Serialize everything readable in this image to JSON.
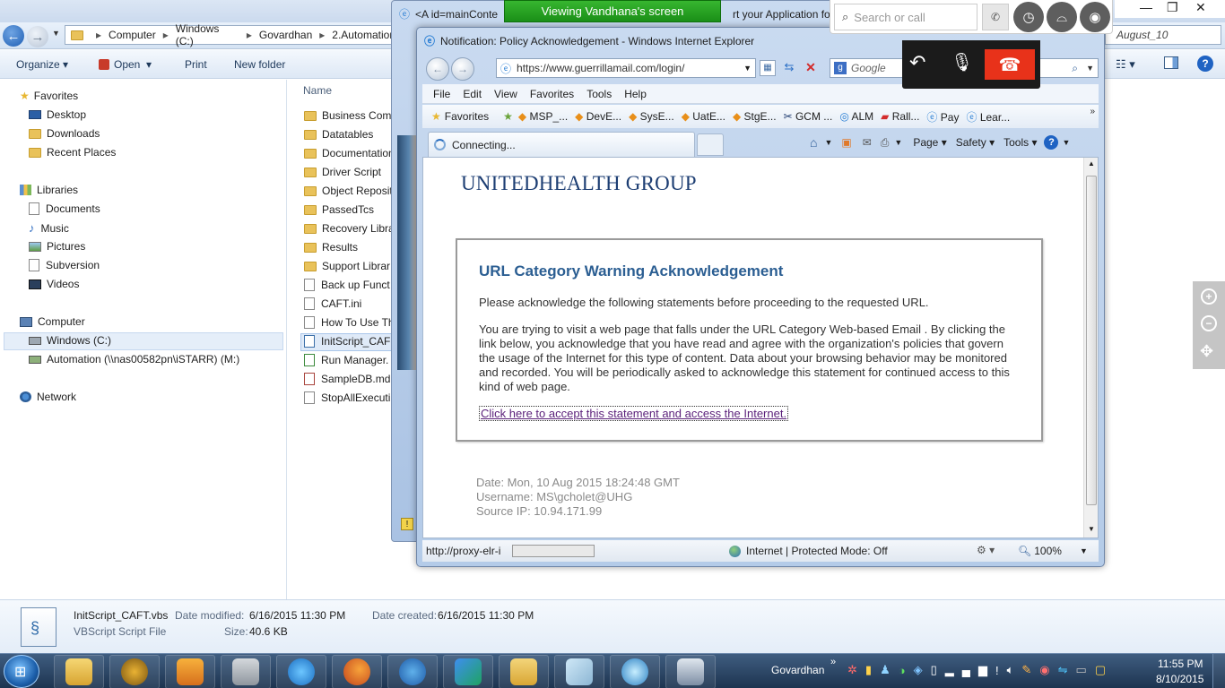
{
  "explorer": {
    "breadcrumb": [
      "Computer",
      "Windows (C:)",
      "Govardhan",
      "2.Automation"
    ],
    "toolbar": {
      "organize": "Organize",
      "open": "Open",
      "print": "Print",
      "new_folder": "New folder"
    },
    "column_header": "Name",
    "right_crumb": "August_10",
    "nav": {
      "favorites": "Favorites",
      "favorites_items": [
        "Desktop",
        "Downloads",
        "Recent Places"
      ],
      "libraries": "Libraries",
      "library_items": [
        "Documents",
        "Music",
        "Pictures",
        "Subversion",
        "Videos"
      ],
      "computer": "Computer",
      "computer_items": [
        "Windows (C:)",
        "Automation (\\\\nas00582pn\\iSTARR) (M:)"
      ],
      "network": "Network"
    },
    "files": [
      "Business Comp",
      "Datatables",
      "Documentation",
      "Driver Script",
      "Object Reposit",
      "PassedTcs",
      "Recovery Libra",
      "Results",
      "Support Librar",
      "Back up Funct",
      "CAFT.ini",
      "How To Use Th",
      "InitScript_CAF",
      "Run Manager.",
      "SampleDB.md",
      "StopAllExecuti"
    ],
    "details": {
      "filename": "InitScript_CAFT.vbs",
      "filetype": "VBScript Script File",
      "modified_label": "Date modified:",
      "modified": "6/16/2015 11:30 PM",
      "created_label": "Date created:",
      "created": "6/16/2015 11:30 PM",
      "size_label": "Size:",
      "size": "40.6 KB"
    }
  },
  "back_window": {
    "title": "<A id=mainConte",
    "title_right": "rt your Application for"
  },
  "screenshare": {
    "banner": "Viewing Vandhana's screen",
    "search_placeholder": "Search or call"
  },
  "ie": {
    "title": "Notification: Policy Acknowledgement - Windows Internet Explorer",
    "url": "https://www.guerrillamail.com/login/",
    "search_engine": "Google",
    "menu": [
      "File",
      "Edit",
      "View",
      "Favorites",
      "Tools",
      "Help"
    ],
    "favorites_label": "Favorites",
    "fav_links": [
      "MSP_...",
      "DevE...",
      "SysE...",
      "UatE...",
      "StgE...",
      "GCM ...",
      "ALM",
      "Rall...",
      "Pay",
      "Lear..."
    ],
    "tab_label": "Connecting...",
    "cmd": {
      "page": "Page",
      "safety": "Safety",
      "tools": "Tools"
    },
    "status_url": "http://proxy-elr-i",
    "zone": "Internet | Protected Mode: Off",
    "zoom": "100%"
  },
  "page": {
    "logo": "UNITEDHEALTH GROUP",
    "heading": "URL Category Warning Acknowledgement",
    "intro": "Please acknowledge the following statements before proceeding to the requested URL.",
    "body": "You are trying to visit a web page that falls under the URL Category Web-based Email . By clicking the link below, you acknowledge that you have read and agree with the organization's policies that govern the usage of the Internet for this type of content. Data about your browsing behavior may be monitored and recorded. You will be periodically asked to acknowledge this statement for continued access to this kind of web page.",
    "link": "Click here to accept this statement and access the Internet.",
    "date": "Date: Mon, 10 Aug 2015 18:24:48 GMT",
    "username": "Username: MS\\gcholet@UHG",
    "source_ip": "Source IP: 10.94.171.99"
  },
  "taskbar": {
    "user": "Govardhan",
    "time": "11:55 PM",
    "date": "8/10/2015"
  }
}
